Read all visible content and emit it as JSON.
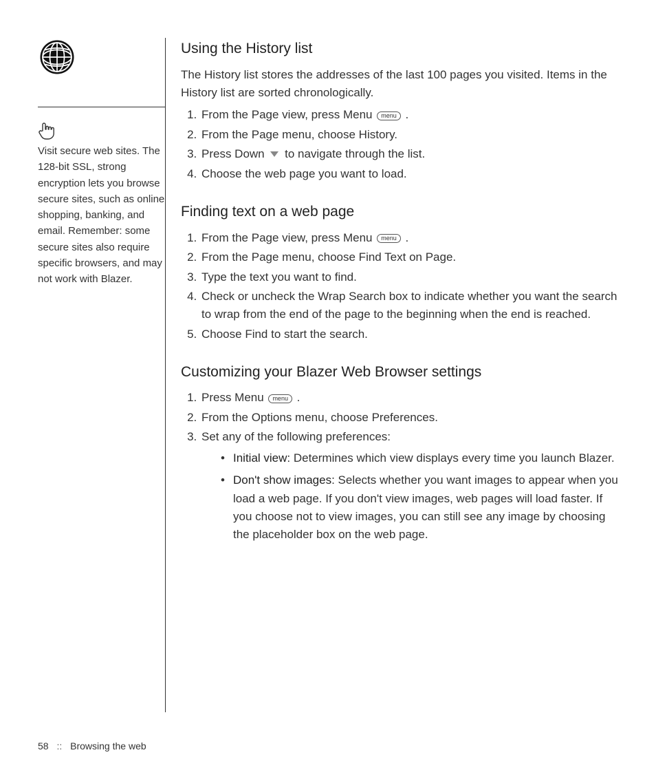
{
  "sidebar": {
    "tip": "Visit secure web sites. The 128-bit SSL, strong encryption lets you browse secure sites, such as online shopping, banking, and email. Remember: some secure sites also require specific browsers, and may not work with Blazer."
  },
  "icons": {
    "globe_name": "globe-icon",
    "hand_name": "hand-pointing-icon",
    "menu_key": "menu",
    "down_arrow": "down-arrow-icon"
  },
  "section1": {
    "heading": "Using the History list",
    "intro": "The History list stores the addresses of the last 100 pages you visited. Items in the History list are sorted chronologically.",
    "step1_a": "From the Page view, press Menu ",
    "step1_b": " .",
    "step2": "From the Page menu, choose History.",
    "step3_a": "Press Down ",
    "step3_b": " to navigate through the list.",
    "step4": "Choose the web page you want to load."
  },
  "section2": {
    "heading": "Finding text on a web page",
    "step1_a": "From the Page view, press Menu ",
    "step1_b": " .",
    "step2": "From the Page menu, choose Find Text on Page.",
    "step3": "Type the text you want to find.",
    "step4": "Check or uncheck the Wrap Search box to indicate whether you want the search to wrap from the end of the page to the beginning when the end is reached.",
    "step5": "Choose Find to start the search."
  },
  "section3": {
    "heading": "Customizing your Blazer Web Browser settings",
    "step1_a": "Press Menu ",
    "step1_b": " .",
    "step2": "From the Options menu, choose Preferences.",
    "step3": "Set any of the following preferences:",
    "bullet1_label": "Initial view:",
    "bullet1_text": " Determines which view displays every time you launch Blazer.",
    "bullet2_label": "Don't show images:",
    "bullet2_text": " Selects whether you want images to appear when you load a web page. If you don't view images, web pages will load faster. If you choose not to view images, you can still see any image by choosing the placeholder box on the web page."
  },
  "footer": {
    "page_number": "58",
    "separator": "::",
    "chapter": "Browsing the web"
  }
}
